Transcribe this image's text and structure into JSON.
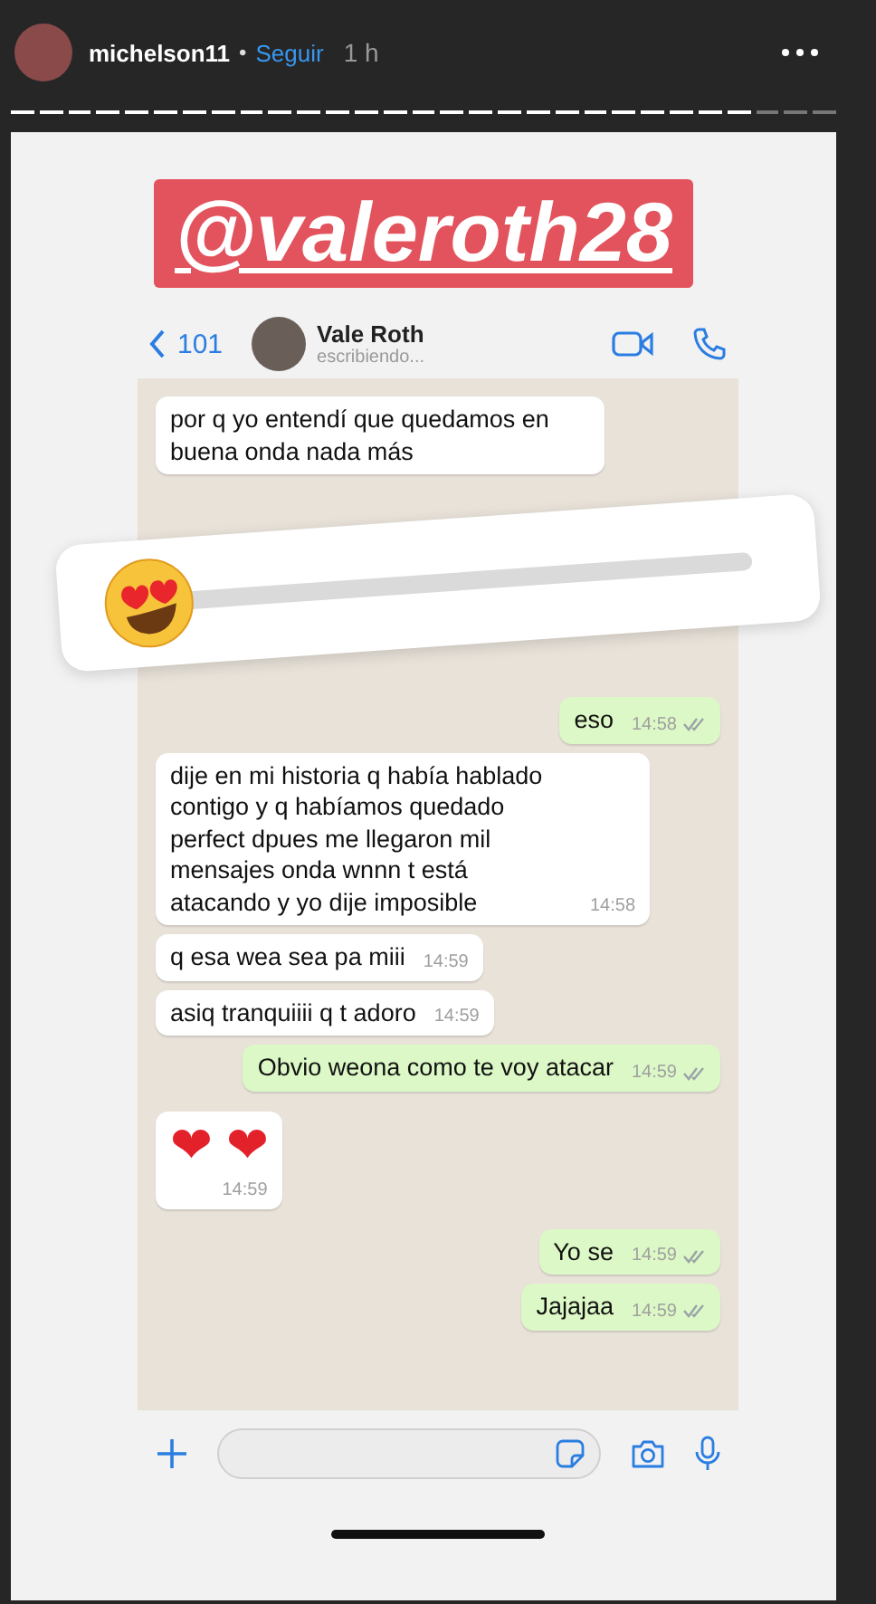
{
  "story_header": {
    "username": "michelson11",
    "separator": "•",
    "follow": "Seguir",
    "age": "1 h"
  },
  "story_segments": [
    {
      "viewed": true
    },
    {
      "viewed": true
    },
    {
      "viewed": true
    },
    {
      "viewed": true
    },
    {
      "viewed": true
    },
    {
      "viewed": true
    },
    {
      "viewed": true
    },
    {
      "viewed": true
    },
    {
      "viewed": true
    },
    {
      "viewed": true
    },
    {
      "viewed": true
    },
    {
      "viewed": true
    },
    {
      "viewed": true
    },
    {
      "viewed": true
    },
    {
      "viewed": true
    },
    {
      "viewed": true
    },
    {
      "viewed": true
    },
    {
      "viewed": true
    },
    {
      "viewed": true
    },
    {
      "viewed": true
    },
    {
      "viewed": true
    },
    {
      "viewed": true
    },
    {
      "viewed": true
    },
    {
      "viewed": true
    },
    {
      "viewed": true
    },
    {
      "viewed": true
    },
    {
      "viewed": false
    },
    {
      "viewed": false
    },
    {
      "viewed": false
    }
  ],
  "mention": "@valeroth28",
  "chat_header": {
    "back_count": "101",
    "contact": "Vale Roth",
    "status": "escribiendo..."
  },
  "messages": [
    {
      "outgoing": false,
      "kind": "text",
      "text": "por q yo entendí que quedamos en buena onda nada más",
      "ticks": false
    },
    {
      "outgoing": true,
      "kind": "text",
      "text": "eso",
      "time": "14:58",
      "ticks": true
    },
    {
      "outgoing": false,
      "kind": "text",
      "text": "dije en mi historia q había hablado contigo y q habíamos quedado perfect dpues me llegaron mil mensajes onda wnnn t está atacando y yo dije imposible",
      "time": "14:58",
      "ticks": false
    },
    {
      "outgoing": false,
      "kind": "text",
      "text": "q esa wea sea pa miii",
      "time": "14:59",
      "ticks": false
    },
    {
      "outgoing": false,
      "kind": "text",
      "text": "asiq tranquiiii q t adoro",
      "time": "14:59",
      "ticks": false
    },
    {
      "outgoing": true,
      "kind": "text",
      "text": "Obvio weona como te voy atacar",
      "time": "14:59",
      "ticks": true
    },
    {
      "outgoing": false,
      "kind": "emoji",
      "text": "❤ ❤",
      "time": "14:59",
      "ticks": false
    },
    {
      "outgoing": true,
      "kind": "text",
      "text": "Yo se",
      "time": "14:59",
      "ticks": true
    },
    {
      "outgoing": true,
      "kind": "text",
      "text": "Jajajaa",
      "time": "14:59",
      "ticks": true
    }
  ],
  "slider_sticker": {
    "level": 0
  }
}
